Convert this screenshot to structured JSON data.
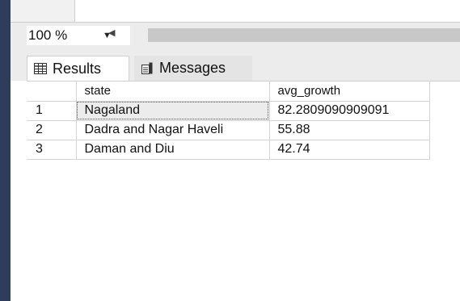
{
  "zoom": {
    "value": "100 %"
  },
  "tabs": {
    "results_label": "Results",
    "messages_label": "Messages"
  },
  "grid": {
    "columns": [
      "",
      "state",
      "avg_growth"
    ],
    "rows": [
      {
        "num": "1",
        "state": "Nagaland",
        "avg_growth": "82.2809090909091"
      },
      {
        "num": "2",
        "state": "Dadra and Nagar Haveli",
        "avg_growth": "55.88"
      },
      {
        "num": "3",
        "state": "Daman and Diu",
        "avg_growth": "42.74"
      }
    ]
  },
  "colors": {
    "left_bar": "#2f3c5a",
    "toolbar_bg": "#ececec",
    "grid_line": "#d4d4d4"
  },
  "icons": {
    "results": "grid-icon",
    "messages": "document-icon",
    "zoom_dropdown": "caret-down-icon",
    "scroll_left": "caret-left-icon"
  }
}
